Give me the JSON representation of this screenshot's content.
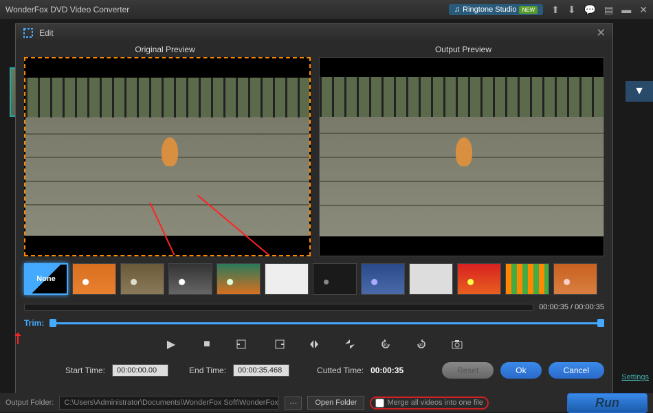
{
  "titlebar": {
    "app_title": "WonderFox DVD Video Converter",
    "ringtone_label": "Ringtone Studio",
    "new_badge": "NEW"
  },
  "edit": {
    "dialog_title": "Edit",
    "original_label": "Original Preview",
    "output_label": "Output Preview",
    "effects": {
      "none_label": "None"
    },
    "time_display": "00:00:35 / 00:00:35",
    "trim_label": "Trim:",
    "start_label": "Start Time:",
    "start_value": "00:00:00.00",
    "end_label": "End Time:",
    "end_value": "00:00:35.468",
    "cutted_label": "Cutted Time:",
    "cutted_value": "00:00:35",
    "reset_label": "Reset",
    "ok_label": "Ok",
    "cancel_label": "Cancel"
  },
  "bottom": {
    "output_folder_label": "Output Folder:",
    "output_path": "C:\\Users\\Administrator\\Documents\\WonderFox Soft\\WonderFox DVD Vid",
    "open_folder_label": "Open Folder",
    "merge_label": "Merge all videos into one file",
    "run_label": "Run"
  },
  "settings_label": "Settings"
}
